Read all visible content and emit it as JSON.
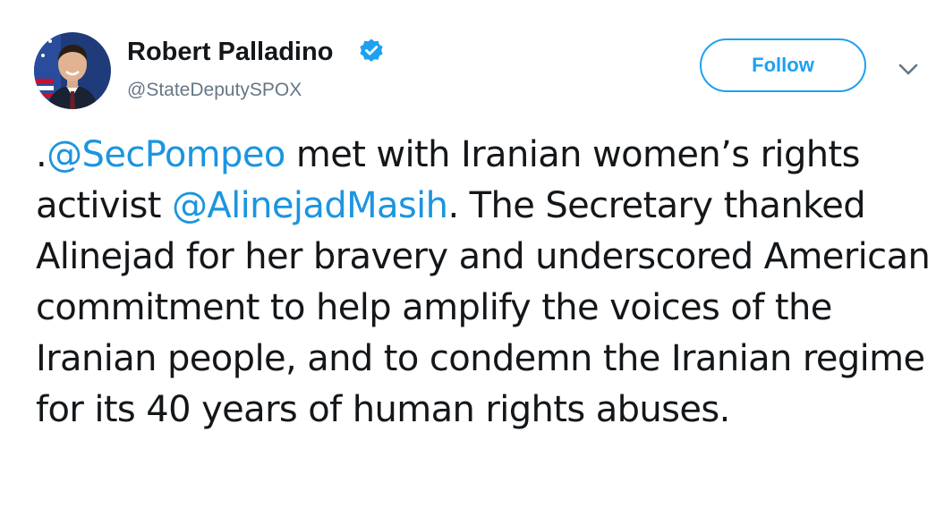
{
  "author": {
    "name": "Robert Palladino",
    "handle": "@StateDeputySPOX",
    "verified": true,
    "avatar": "profile-photo"
  },
  "actions": {
    "follow_label": "Follow",
    "menu_icon": "chevron-down-icon"
  },
  "tweet": {
    "lead": ".",
    "mention_1": "@SecPompeo",
    "text_1": " met with Iranian women’s rights activist ",
    "mention_2": "@AlinejadMasih",
    "text_2": ". The Secretary thanked Alinejad for her bravery and underscored American commitment to help amplify the voices of the Iranian people, and to condemn the Iranian regime for its 40 years of human rights abuses."
  },
  "colors": {
    "accent": "#1da1f2",
    "link": "#1b95e0",
    "text": "#14171a",
    "secondary": "#657786"
  }
}
